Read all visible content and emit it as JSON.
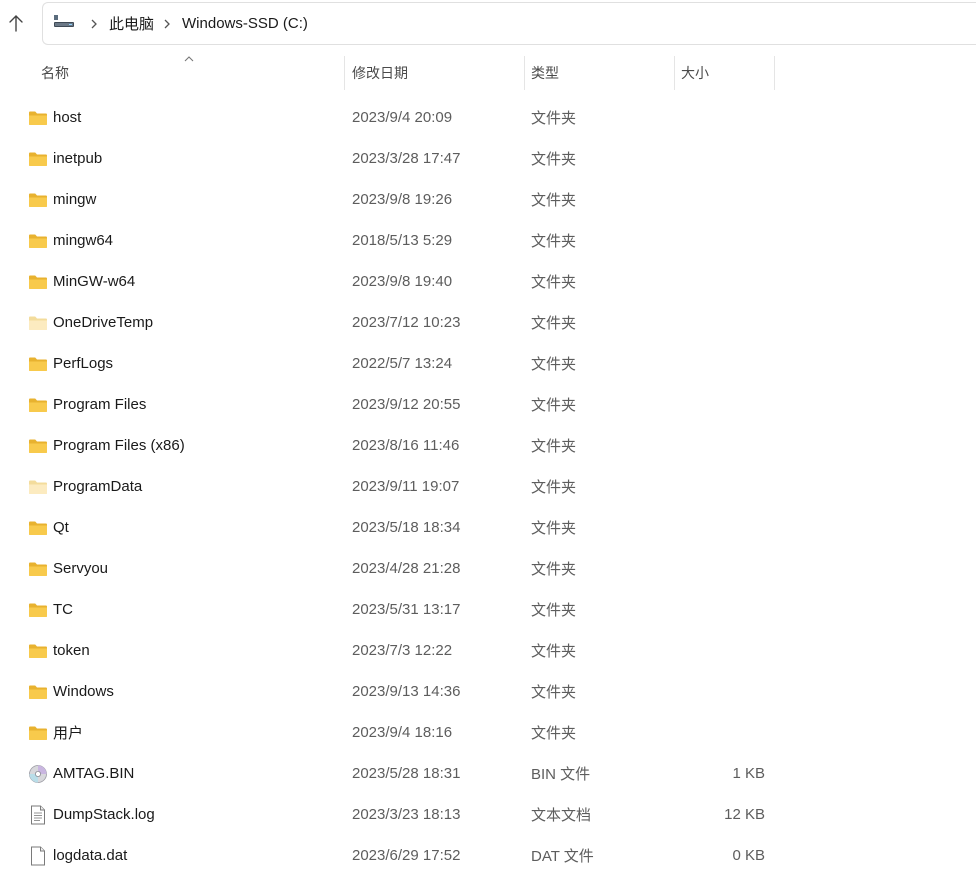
{
  "address": {
    "crumbs": [
      "此电脑",
      "Windows-SSD (C:)"
    ]
  },
  "columns": {
    "name": "名称",
    "date": "修改日期",
    "type": "类型",
    "size": "大小"
  },
  "colors": {
    "folder": "#f5c542",
    "folder_dark": "#e8b22f",
    "folder_faded": "#fbe5a6"
  },
  "files": [
    {
      "name": "host",
      "date": "2023/9/4 20:09",
      "type": "文件夹",
      "size": "",
      "icon": "folder-icon"
    },
    {
      "name": "inetpub",
      "date": "2023/3/28 17:47",
      "type": "文件夹",
      "size": "",
      "icon": "folder-icon"
    },
    {
      "name": "mingw",
      "date": "2023/9/8 19:26",
      "type": "文件夹",
      "size": "",
      "icon": "folder-icon"
    },
    {
      "name": "mingw64",
      "date": "2018/5/13 5:29",
      "type": "文件夹",
      "size": "",
      "icon": "folder-icon"
    },
    {
      "name": "MinGW-w64",
      "date": "2023/9/8 19:40",
      "type": "文件夹",
      "size": "",
      "icon": "folder-icon"
    },
    {
      "name": "OneDriveTemp",
      "date": "2023/7/12 10:23",
      "type": "文件夹",
      "size": "",
      "icon": "hidden-folder-icon"
    },
    {
      "name": "PerfLogs",
      "date": "2022/5/7 13:24",
      "type": "文件夹",
      "size": "",
      "icon": "folder-icon"
    },
    {
      "name": "Program Files",
      "date": "2023/9/12 20:55",
      "type": "文件夹",
      "size": "",
      "icon": "folder-icon"
    },
    {
      "name": "Program Files (x86)",
      "date": "2023/8/16 11:46",
      "type": "文件夹",
      "size": "",
      "icon": "folder-icon"
    },
    {
      "name": "ProgramData",
      "date": "2023/9/11 19:07",
      "type": "文件夹",
      "size": "",
      "icon": "hidden-folder-icon"
    },
    {
      "name": "Qt",
      "date": "2023/5/18 18:34",
      "type": "文件夹",
      "size": "",
      "icon": "folder-icon"
    },
    {
      "name": "Servyou",
      "date": "2023/4/28 21:28",
      "type": "文件夹",
      "size": "",
      "icon": "folder-icon"
    },
    {
      "name": "TC",
      "date": "2023/5/31 13:17",
      "type": "文件夹",
      "size": "",
      "icon": "folder-icon"
    },
    {
      "name": "token",
      "date": "2023/7/3 12:22",
      "type": "文件夹",
      "size": "",
      "icon": "folder-icon"
    },
    {
      "name": "Windows",
      "date": "2023/9/13 14:36",
      "type": "文件夹",
      "size": "",
      "icon": "folder-icon"
    },
    {
      "name": "用户",
      "date": "2023/9/4 18:16",
      "type": "文件夹",
      "size": "",
      "icon": "folder-icon"
    },
    {
      "name": "AMTAG.BIN",
      "date": "2023/5/28 18:31",
      "type": "BIN 文件",
      "size": "1 KB",
      "icon": "disc-file-icon"
    },
    {
      "name": "DumpStack.log",
      "date": "2023/3/23 18:13",
      "type": "文本文档",
      "size": "12 KB",
      "icon": "text-file-icon"
    },
    {
      "name": "logdata.dat",
      "date": "2023/6/29 17:52",
      "type": "DAT 文件",
      "size": "0 KB",
      "icon": "blank-file-icon"
    }
  ]
}
